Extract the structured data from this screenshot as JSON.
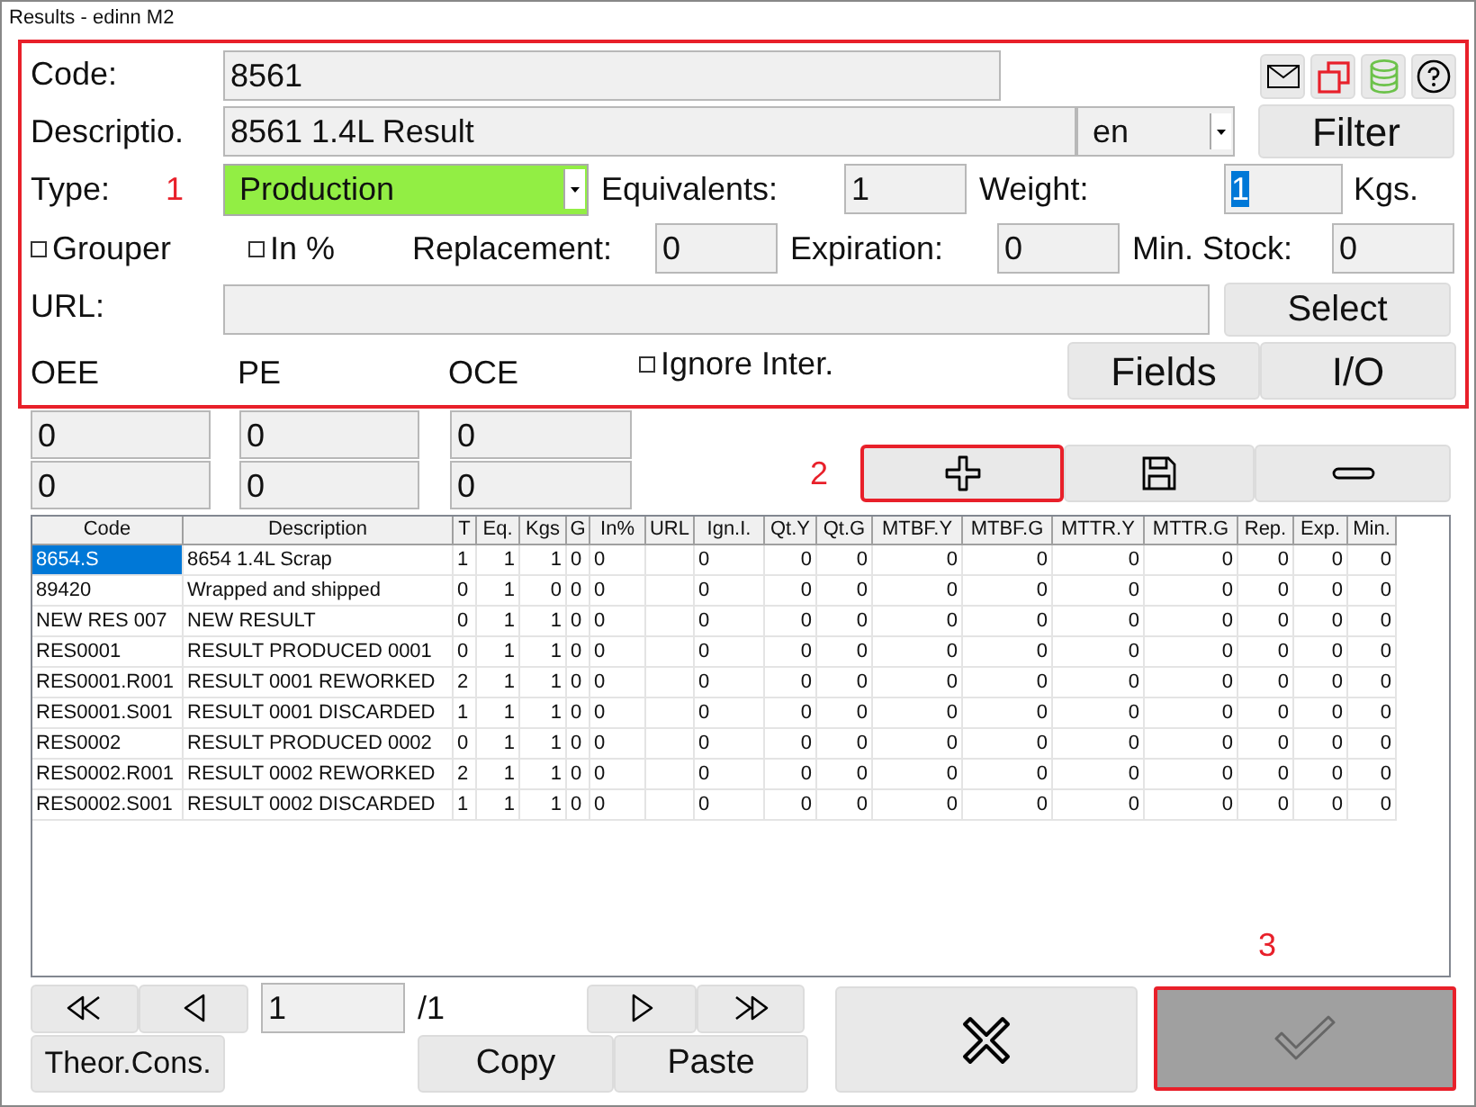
{
  "window": {
    "title": "Results - edinn M2"
  },
  "form": {
    "highlighted": true,
    "code": {
      "label": "Code:",
      "value": "8561"
    },
    "description": {
      "label": "Descriptio.",
      "value": "8561 1.4L Result",
      "language": "en"
    },
    "filter_button": "Filter",
    "type": {
      "label": "Type:",
      "value": "Production"
    },
    "equivalents": {
      "label": "Equivalents:",
      "value": "1"
    },
    "weight": {
      "label": "Weight:",
      "value": "1",
      "text_selected": true,
      "unit": "Kgs."
    },
    "grouper": {
      "label": "Grouper",
      "checked": false
    },
    "in_percent": {
      "label": "In %",
      "checked": false
    },
    "replacement": {
      "label": "Replacement:",
      "value": "0"
    },
    "expiration": {
      "label": "Expiration:",
      "value": "0"
    },
    "min_stock": {
      "label": "Min. Stock:",
      "value": "0"
    },
    "url": {
      "label": "URL:"
    },
    "select_button": "Select",
    "metrics": [
      {
        "label": "OEE",
        "values": [
          "0",
          "0"
        ]
      },
      {
        "label": "PE",
        "values": [
          "0",
          "0"
        ]
      },
      {
        "label": "OCE",
        "values": [
          "0",
          "0"
        ]
      }
    ],
    "ignore_inter": {
      "label": "Ignore Inter.",
      "checked": false
    },
    "fields_button": "Fields",
    "io_button": "I/O"
  },
  "markers": [
    "1",
    "2",
    "3"
  ],
  "add_button": {
    "highlighted": true
  },
  "table": {
    "columns": [
      "Code",
      "Description",
      "T",
      "Eq.",
      "Kgs",
      "G",
      "In%",
      "URL",
      "Ign.I.",
      "Qt.Y",
      "Qt.G",
      "MTBF.Y",
      "MTBF.G",
      "MTTR.Y",
      "MTTR.G",
      "Rep.",
      "Exp.",
      "Min."
    ],
    "rows": [
      {
        "selected": true,
        "cells": [
          "8654.S",
          "8654 1.4L Scrap",
          "1",
          "1",
          "1",
          "0",
          "0",
          "",
          "0",
          "0",
          "0",
          "0",
          "0",
          "0",
          "0",
          "0",
          "0",
          "0"
        ]
      },
      {
        "selected": false,
        "cells": [
          "89420",
          "Wrapped and shipped",
          "0",
          "1",
          "0",
          "0",
          "0",
          "",
          "0",
          "0",
          "0",
          "0",
          "0",
          "0",
          "0",
          "0",
          "0",
          "0"
        ]
      },
      {
        "selected": false,
        "cells": [
          "NEW RES 007",
          "NEW RESULT",
          "0",
          "1",
          "1",
          "0",
          "0",
          "",
          "0",
          "0",
          "0",
          "0",
          "0",
          "0",
          "0",
          "0",
          "0",
          "0"
        ]
      },
      {
        "selected": false,
        "cells": [
          "RES0001",
          "RESULT PRODUCED 0001",
          "0",
          "1",
          "1",
          "0",
          "0",
          "",
          "0",
          "0",
          "0",
          "0",
          "0",
          "0",
          "0",
          "0",
          "0",
          "0"
        ]
      },
      {
        "selected": false,
        "cells": [
          "RES0001.R001",
          "RESULT 0001 REWORKED",
          "2",
          "1",
          "1",
          "0",
          "0",
          "",
          "0",
          "0",
          "0",
          "0",
          "0",
          "0",
          "0",
          "0",
          "0",
          "0"
        ]
      },
      {
        "selected": false,
        "cells": [
          "RES0001.S001",
          "RESULT 0001 DISCARDED",
          "1",
          "1",
          "1",
          "0",
          "0",
          "",
          "0",
          "0",
          "0",
          "0",
          "0",
          "0",
          "0",
          "0",
          "0",
          "0"
        ]
      },
      {
        "selected": false,
        "cells": [
          "RES0002",
          "RESULT PRODUCED 0002",
          "0",
          "1",
          "1",
          "0",
          "0",
          "",
          "0",
          "0",
          "0",
          "0",
          "0",
          "0",
          "0",
          "0",
          "0",
          "0"
        ]
      },
      {
        "selected": false,
        "cells": [
          "RES0002.R001",
          "RESULT 0002 REWORKED",
          "2",
          "1",
          "1",
          "0",
          "0",
          "",
          "0",
          "0",
          "0",
          "0",
          "0",
          "0",
          "0",
          "0",
          "0",
          "0"
        ]
      },
      {
        "selected": false,
        "cells": [
          "RES0002.S001",
          "RESULT 0002 DISCARDED",
          "1",
          "1",
          "1",
          "0",
          "0",
          "",
          "0",
          "0",
          "0",
          "0",
          "0",
          "0",
          "0",
          "0",
          "0",
          "0"
        ]
      }
    ]
  },
  "pager": {
    "page": "1",
    "total": "/1"
  },
  "theor_cons_button": "Theor.Cons.",
  "copy_button": "Copy",
  "paste_button": "Paste",
  "confirm_button": {
    "disabled": true,
    "highlighted": true
  }
}
